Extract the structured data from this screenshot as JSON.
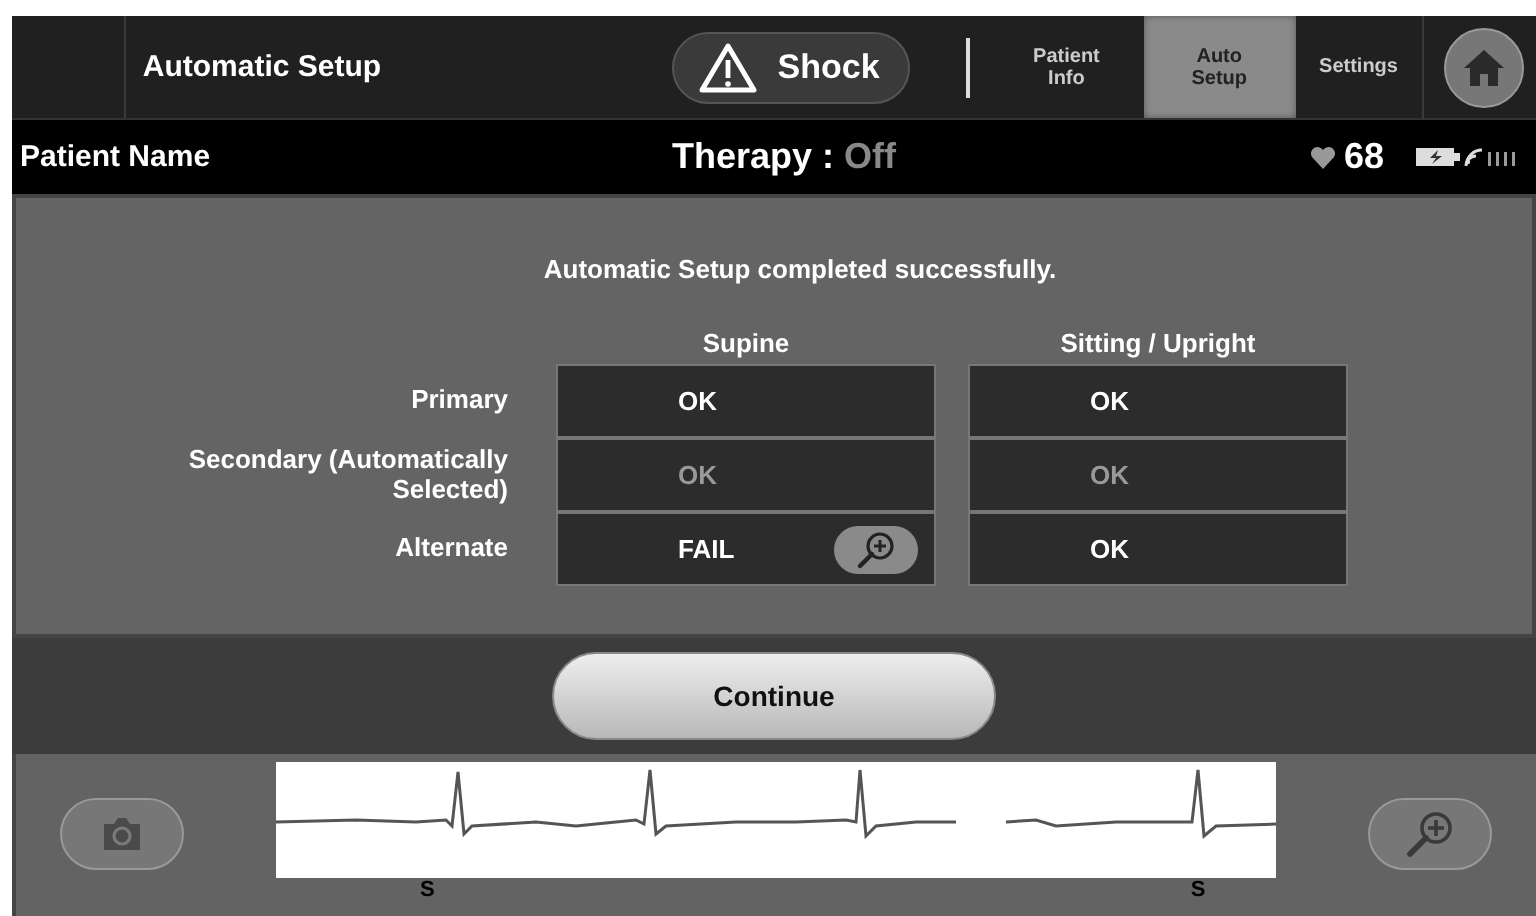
{
  "header": {
    "title": "Automatic Setup",
    "shock_button": "Shock",
    "tabs": [
      {
        "label": "Patient Info",
        "selected": false
      },
      {
        "label": "Auto Setup",
        "selected": true
      },
      {
        "label": "Settings",
        "selected": false
      }
    ]
  },
  "status_bar": {
    "patient_name": "Patient Name",
    "therapy_label": "Therapy :",
    "therapy_value": "Off",
    "heart_rate": "68"
  },
  "message": "Automatic Setup completed successfully.",
  "results": {
    "columns": [
      "Supine",
      "Sitting / Upright"
    ],
    "rows": [
      {
        "label": "Primary",
        "dimmed": false,
        "cells": [
          {
            "value": "OK",
            "zoom": false
          },
          {
            "value": "OK",
            "zoom": false
          }
        ]
      },
      {
        "label": "Secondary (Automatically Selected)",
        "dimmed": true,
        "cells": [
          {
            "value": "OK",
            "zoom": false
          },
          {
            "value": "OK",
            "zoom": false
          }
        ]
      },
      {
        "label": "Alternate",
        "dimmed": false,
        "cells": [
          {
            "value": "FAIL",
            "zoom": true
          },
          {
            "value": "OK",
            "zoom": false
          }
        ]
      }
    ]
  },
  "continue_button": "Continue",
  "ecg": {
    "markers": [
      "S",
      "S"
    ]
  }
}
